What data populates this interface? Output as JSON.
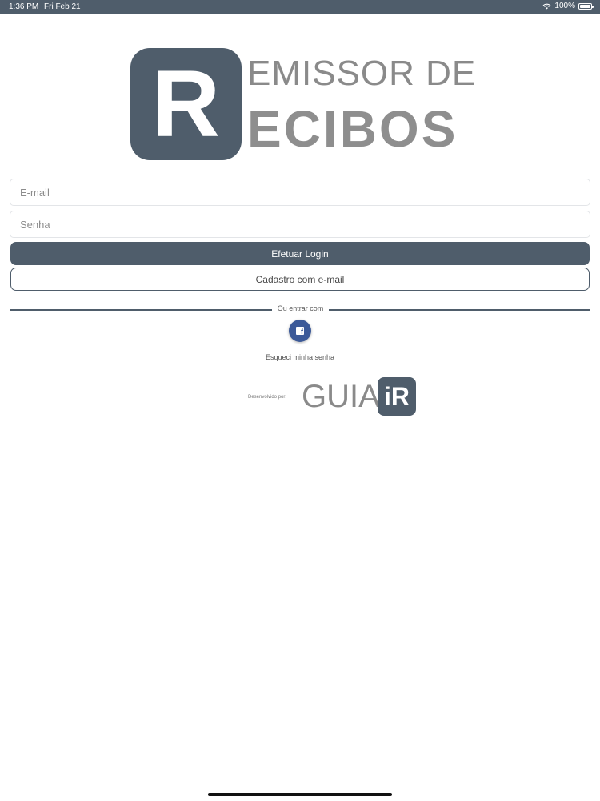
{
  "status_bar": {
    "time": "1:36 PM",
    "date": "Fri Feb 21",
    "battery": "100%",
    "wifi_icon": "wifi-icon",
    "battery_icon": "battery-icon"
  },
  "logo": {
    "badge_letter": "R",
    "line1": "EMISSOR DE",
    "line2": "ECIBOS"
  },
  "form": {
    "email_placeholder": "E-mail",
    "password_placeholder": "Senha",
    "login_label": "Efetuar Login",
    "signup_label": "Cadastro com e-mail"
  },
  "divider": {
    "label": "Ou entrar com"
  },
  "social": {
    "facebook_icon": "facebook-icon",
    "facebook_glyph": "f"
  },
  "forgot_password": "Esqueci minha senha",
  "footer": {
    "developed_by": "Desenvolvido por:",
    "brand_text": "GUIA",
    "brand_badge": "iR"
  },
  "colors": {
    "primary": "#4f5d6b",
    "facebook": "#3b5998",
    "logo_gray": "#8a8a8a"
  }
}
